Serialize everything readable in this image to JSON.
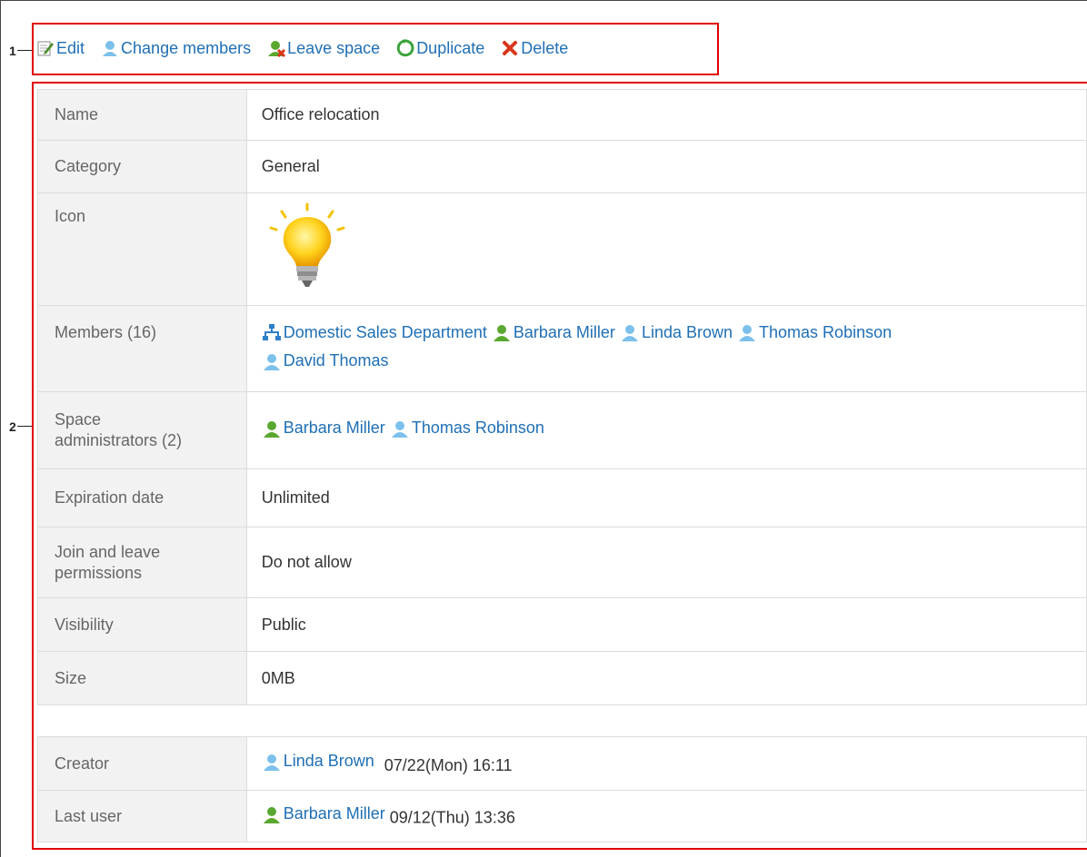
{
  "callouts": {
    "one": "1",
    "two": "2"
  },
  "toolbar": {
    "edit": "Edit",
    "change_members": "Change members",
    "leave_space": "Leave space",
    "duplicate": "Duplicate",
    "delete": "Delete"
  },
  "details": {
    "name_label": "Name",
    "name_value": "Office relocation",
    "category_label": "Category",
    "category_value": "General",
    "icon_label": "Icon",
    "icon_name": "lightbulb-icon",
    "members_label": "Members (16)",
    "members": [
      "Domestic Sales Department",
      "Barbara Miller",
      "Linda Brown",
      "Thomas Robinson",
      "David Thomas"
    ],
    "admins_label_1": "Space",
    "admins_label_2": "administrators (2)",
    "admins": [
      "Barbara Miller",
      "Thomas Robinson"
    ],
    "expiration_label": "Expiration date",
    "expiration_value": "Unlimited",
    "join_label_1": "Join and leave",
    "join_label_2": "permissions",
    "join_value": "Do not allow",
    "visibility_label": "Visibility",
    "visibility_value": "Public",
    "size_label": "Size",
    "size_value": "0MB"
  },
  "history": {
    "creator_label": "Creator",
    "creator_name": "Linda Brown",
    "creator_time": "07/22(Mon) 16:11",
    "last_label": "Last user",
    "last_name": "Barbara Miller",
    "last_time": "09/12(Thu) 13:36"
  },
  "colors": {
    "link": "#1f6fb5",
    "highlight": "#e00000",
    "label_bg": "#f2f2f2",
    "user_green": "#5aa830",
    "user_blue": "#7cc0ec"
  }
}
